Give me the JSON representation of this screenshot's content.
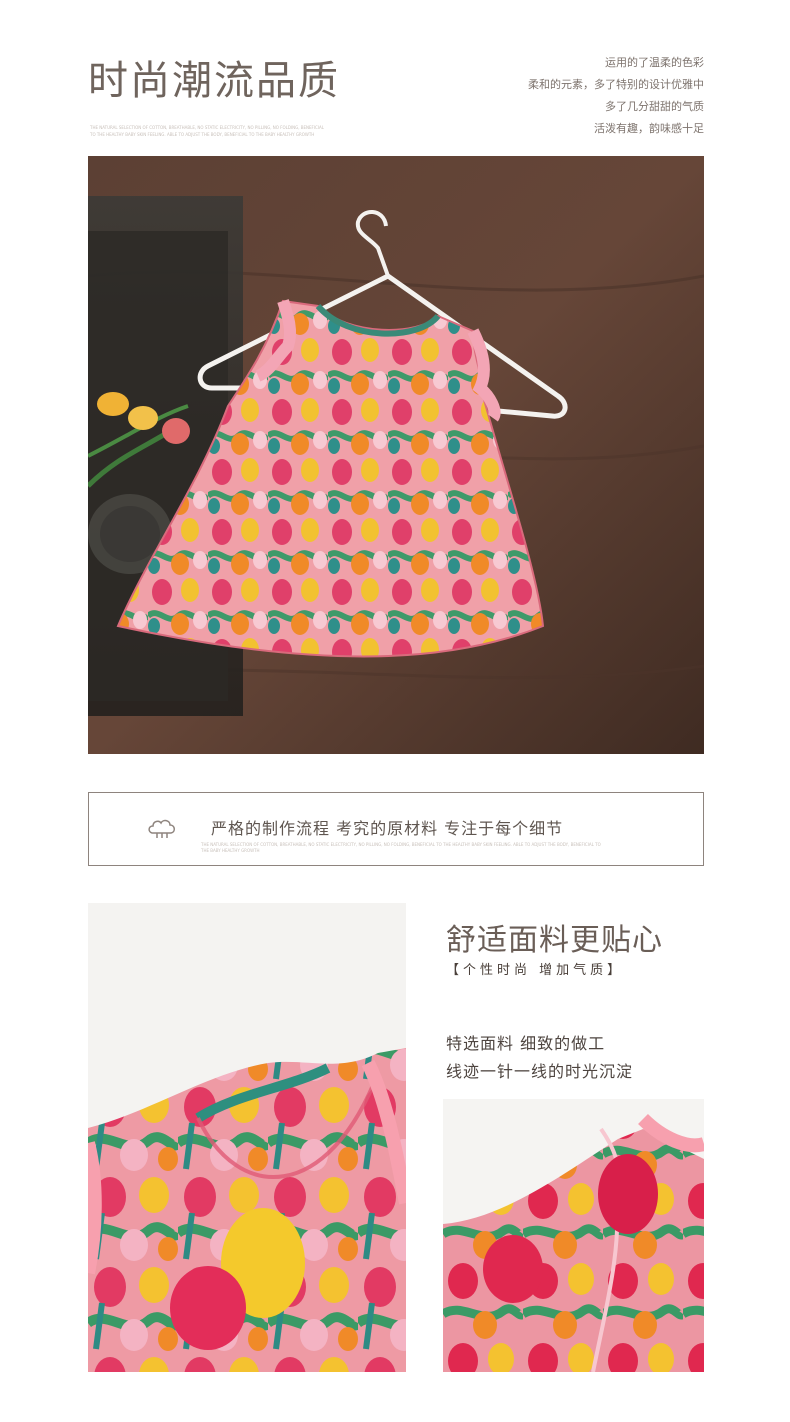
{
  "section1": {
    "title": "时尚潮流品质",
    "tiny_caption": "THE NATURAL SELECTION OF COTTON, BREATHABLE, NO STATIC ELECTRICITY, NO PILLING, NO FOLDING, BENEFICIAL TO THE HEALTHY BABY SKIN FEELING. ABLE TO ADJUST THE BODY, BENEFICIAL TO THE BABY HEALTHY GROWTH",
    "side_lines": [
      "运用的了温柔的色彩",
      "柔和的元素，多了特别的设计优雅中",
      "多了几分甜甜的气质",
      "活泼有趣，韵味感十足"
    ]
  },
  "banner": {
    "text": "严格的制作流程 考究的原材料 专注于每个细节",
    "tiny_caption": "THE NATURAL SELECTION OF COTTON, BREATHABLE, NO STATIC ELECTRICITY, NO PILLING, NO FOLDING, BENEFICIAL TO THE HEALTHY BABY SKIN FEELING. ABLE TO ADJUST THE BODY, BENEFICIAL TO THE BABY HEALTHY GROWTH"
  },
  "section2": {
    "title": "舒适面料更贴心",
    "subtitle": "【个性时尚  增加气质】",
    "body": [
      "特选面料 细致的做工",
      "线迹一针一线的时光沉淀"
    ]
  },
  "colors": {
    "text_primary": "#6f645d",
    "border": "#8e847e",
    "wood": "#5a3e32",
    "tulip_pink": "#e0406a",
    "tulip_yellow": "#f2c230",
    "tulip_orange": "#f08a28",
    "leaf_green": "#3f9a6a"
  },
  "icons": [
    "cotton-icon"
  ]
}
